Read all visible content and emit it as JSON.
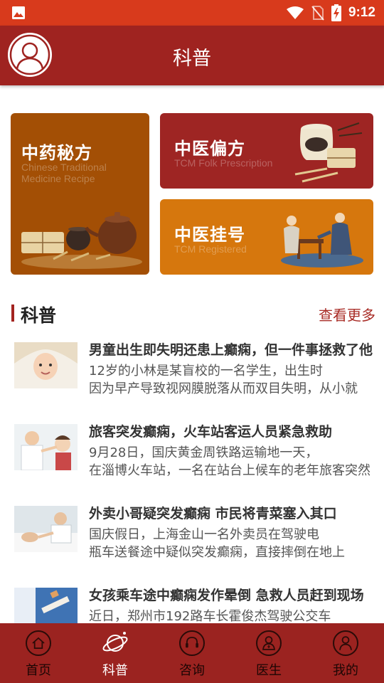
{
  "status_bar": {
    "time": "9:12",
    "icons": [
      "image-icon",
      "wifi-icon",
      "no-sim-icon",
      "battery-charging-icon"
    ]
  },
  "header": {
    "title": "科普",
    "avatar_icon": "user-avatar-icon"
  },
  "features": [
    {
      "title": "中药秘方",
      "subtitle": "Chinese Traditional Medicine Recipe"
    },
    {
      "title": "中医偏方",
      "subtitle": "TCM Folk Prescription"
    },
    {
      "title": "中医挂号",
      "subtitle": "TCM Registered"
    }
  ],
  "section": {
    "title": "科普",
    "more_label": "查看更多"
  },
  "news": [
    {
      "headline": "男童出生即失明还患上癫痫，但一件事拯救了他",
      "line1": "12岁的小林是某盲校的一名学生，出生时",
      "line2": "因为早产导致视网膜脱落从而双目失明，从小就"
    },
    {
      "headline": "旅客突发癫痫，火车站客运人员紧急救助",
      "line1": "9月28日，国庆黄金周铁路运输地一天，",
      "line2": "在淄博火车站，一名在站台上候车的老年旅客突然"
    },
    {
      "headline": "外卖小哥疑突发癫痫 市民将青菜塞入其口",
      "line1": "国庆假日，上海金山一名外卖员在驾驶电",
      "line2": "瓶车送餐途中疑似突发癫痫，直接摔倒在地上"
    },
    {
      "headline": "女孩乘车途中癫痫发作晕倒 急救人员赶到现场",
      "line1": "近日，郑州市192路车长霍俊杰驾驶公交车",
      "line2": ""
    }
  ],
  "bottom_nav": [
    {
      "label": "首页",
      "icon": "home-icon"
    },
    {
      "label": "科普",
      "icon": "planet-icon"
    },
    {
      "label": "咨询",
      "icon": "headset-icon"
    },
    {
      "label": "医生",
      "icon": "doctor-icon"
    },
    {
      "label": "我的",
      "icon": "profile-icon"
    }
  ],
  "colors": {
    "status_bar": "#d83a1c",
    "header": "#9f2320",
    "card_brown": "#a34f05",
    "card_red": "#9e2523",
    "card_orange": "#d6770d",
    "accent_text": "#a82b25",
    "bottom_nav": "#9b2320"
  }
}
